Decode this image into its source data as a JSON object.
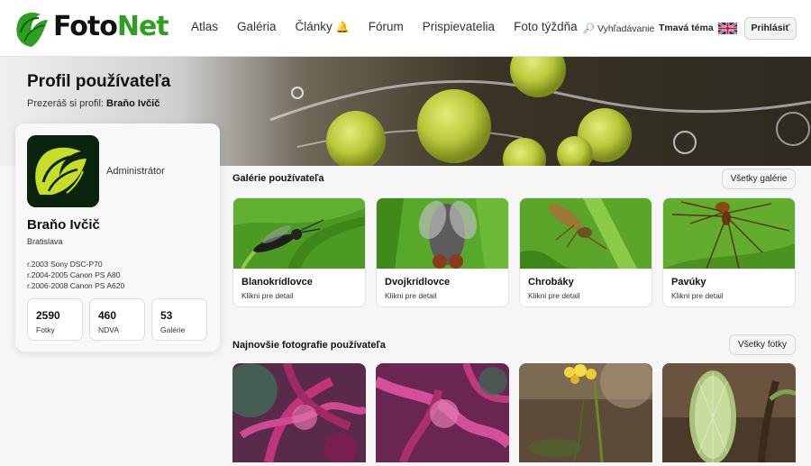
{
  "brand": {
    "name_part1": "Foto",
    "name_part2": "Net"
  },
  "nav": {
    "items": [
      {
        "label": "Atlas"
      },
      {
        "label": "Galéria"
      },
      {
        "label": "Články"
      },
      {
        "label": "Fórum"
      },
      {
        "label": "Prispievatelia"
      },
      {
        "label": "Foto týždňa"
      }
    ],
    "bell_icon": "🔔"
  },
  "header": {
    "search_label": "Vyhľadávanie",
    "dark_mode_label": "Tmavá téma",
    "language_icon": "uk-flag-icon",
    "login_label": "Prihlásiť"
  },
  "hero": {
    "title": "Profil používateľa",
    "viewing_prefix": "Prezeráš si profil:",
    "viewing_name": "Braňo Ivčič"
  },
  "profile": {
    "role": "Administrátor",
    "name": "Braňo Ivčič",
    "city": "Bratislava",
    "cameras": [
      "r.2003 Sony DSC-P70",
      "r.2004-2005 Canon PS A80",
      "r.2006-2008 Canon PS A620"
    ],
    "stats": [
      {
        "value": "2590",
        "label": "Fotky"
      },
      {
        "value": "460",
        "label": "NDVA"
      },
      {
        "value": "53",
        "label": "Galérie"
      }
    ]
  },
  "galleries": {
    "title": "Galérie používateľa",
    "all_label": "Všetky galérie",
    "items": [
      {
        "name": "Blanokrídlovce",
        "detail": "Klikni pre detail"
      },
      {
        "name": "Dvojkrídlovce",
        "detail": "Klikni pre detail"
      },
      {
        "name": "Chrobáky",
        "detail": "Klikni pre detail"
      },
      {
        "name": "Pavúky",
        "detail": "Klikni pre detail"
      }
    ]
  },
  "latest": {
    "title": "Najnovšie fotografie používateľa",
    "all_label": "Všetky fotky"
  },
  "colors": {
    "brand_green": "#2e9f1f",
    "leaf_green": "#5aa52a"
  }
}
